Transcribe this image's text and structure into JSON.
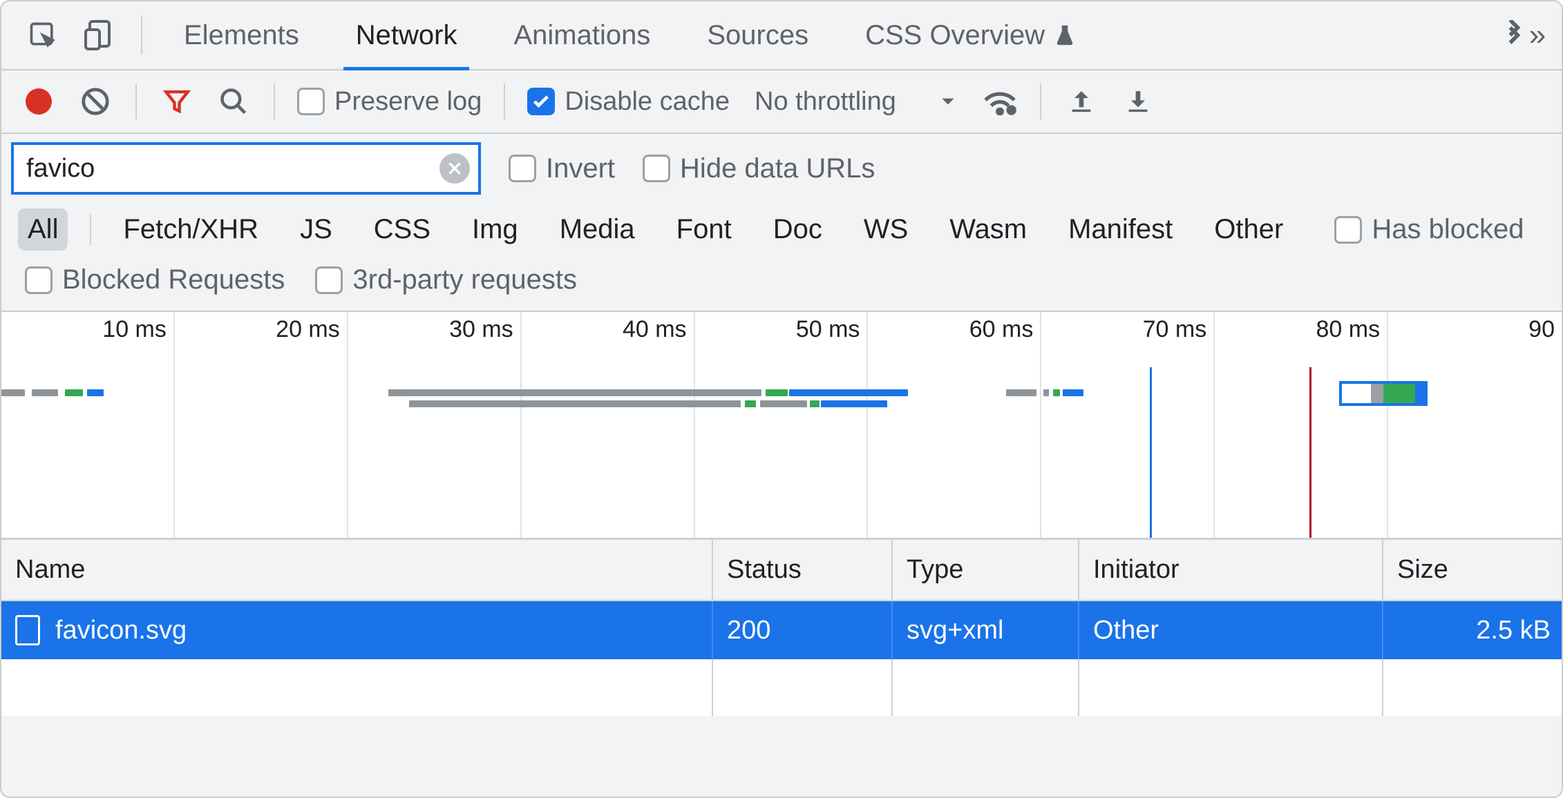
{
  "tabs": {
    "elements": "Elements",
    "network": "Network",
    "animations": "Animations",
    "sources": "Sources",
    "css_overview": "CSS Overview"
  },
  "toolbar": {
    "preserve_log": "Preserve log",
    "disable_cache": "Disable cache",
    "throttling": "No throttling"
  },
  "filter": {
    "value": "favico",
    "invert": "Invert",
    "hide_data_urls": "Hide data URLs"
  },
  "filter_types": {
    "all": "All",
    "fetch": "Fetch/XHR",
    "js": "JS",
    "css": "CSS",
    "img": "Img",
    "media": "Media",
    "font": "Font",
    "doc": "Doc",
    "ws": "WS",
    "wasm": "Wasm",
    "manifest": "Manifest",
    "other": "Other",
    "has_blocked": "Has blocked",
    "blocked_requests": "Blocked Requests",
    "third_party": "3rd-party requests"
  },
  "timeline": {
    "ticks": [
      "10 ms",
      "20 ms",
      "30 ms",
      "40 ms",
      "50 ms",
      "60 ms",
      "70 ms",
      "80 ms",
      "90"
    ]
  },
  "table": {
    "headers": {
      "name": "Name",
      "status": "Status",
      "type": "Type",
      "initiator": "Initiator",
      "size": "Size"
    },
    "row": {
      "name": "favicon.svg",
      "status": "200",
      "type": "svg+xml",
      "initiator": "Other",
      "size": "2.5 kB"
    }
  }
}
